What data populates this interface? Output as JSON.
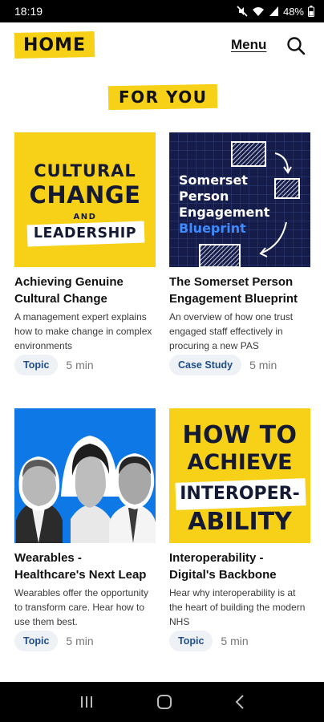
{
  "status_bar": {
    "time": "18:19",
    "battery": "48%",
    "icons": [
      "mute-icon",
      "wifi-icon",
      "signal-icon",
      "battery-icon"
    ]
  },
  "header": {
    "home_label": "HOME",
    "menu_label": "Menu",
    "search_icon": "search-icon"
  },
  "section_title": "FOR YOU",
  "colors": {
    "accent_yellow": "#f7d117",
    "navy": "#151c4a",
    "tag_text": "#1e4f8c",
    "tag_bg": "#eef1f5"
  },
  "cards": [
    {
      "thumb": {
        "lines": [
          "CULTURAL",
          "CHANGE",
          "AND",
          "LEADERSHIP"
        ]
      },
      "title": "Achieving Genuine Cultural Change",
      "description": "A management expert explains how to make change in complex environments",
      "tag": "Topic",
      "duration": "5 min"
    },
    {
      "thumb": {
        "lines": [
          "Somerset",
          "Person",
          "Engagement",
          "Blueprint"
        ]
      },
      "title": "The Somerset Person Engagement Blueprint",
      "description": "An overview of how one trust engaged staff effectively in procuring a new PAS",
      "tag": "Case Study",
      "duration": "5 min"
    },
    {
      "thumb": {
        "lines": []
      },
      "title": "Wearables - Healthcare's Next Leap",
      "description": "Wearables offer the opportunity to transform care. Hear how to use them best.",
      "tag": "Topic",
      "duration": "5 min"
    },
    {
      "thumb": {
        "lines": [
          "HOW TO",
          "ACHIEVE",
          "INTEROPER-",
          "ABILITY"
        ]
      },
      "title": "Interoperability - Digital's Backbone",
      "description": "Hear why interoperability is at the heart of building the modern NHS",
      "tag": "Topic",
      "duration": "5 min"
    }
  ],
  "nav_bar": {
    "icons": [
      "recent-apps-icon",
      "home-circle-icon",
      "back-icon"
    ]
  }
}
